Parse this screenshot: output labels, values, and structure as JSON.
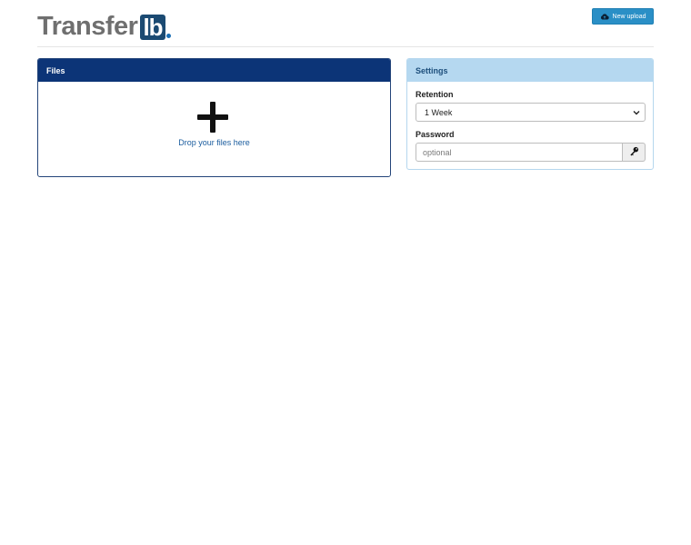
{
  "header": {
    "logo_text": "Transfer",
    "logo_badge": "lb",
    "new_upload_label": "New upload",
    "new_upload_icon": "cloud-upload-icon"
  },
  "files": {
    "heading": "Files",
    "drop_icon": "plus-icon",
    "drop_text": "Drop your files here"
  },
  "settings": {
    "heading": "Settings",
    "retention_label": "Retention",
    "retention_value": "1 Week",
    "password_label": "Password",
    "password_placeholder": "optional",
    "password_button_icon": "key-icon"
  },
  "colors": {
    "files_header_bg": "#0c3477",
    "settings_header_bg": "#b5d8f0",
    "button_bg": "#2a8fc6",
    "drop_text": "#1a5c9e"
  }
}
